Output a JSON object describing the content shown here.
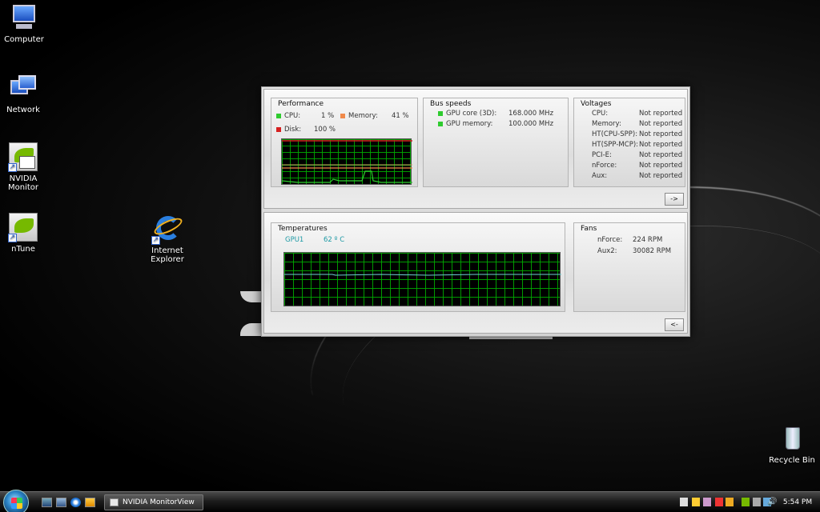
{
  "desktop": {
    "icons": [
      {
        "label": "Computer"
      },
      {
        "label": "Network"
      },
      {
        "label": "NVIDIA Monitor"
      },
      {
        "label": "nTune"
      },
      {
        "label": "Internet Explorer"
      },
      {
        "label": "Recycle Bin"
      }
    ]
  },
  "monitor": {
    "performance": {
      "title": "Performance",
      "cpu_label": "CPU:",
      "cpu_value": "1 %",
      "memory_label": "Memory:",
      "memory_value": "41 %",
      "disk_label": "Disk:",
      "disk_value": "100 %"
    },
    "bus_speeds": {
      "title": "Bus speeds",
      "items": [
        {
          "label": "GPU core (3D):",
          "value": "168.000 MHz"
        },
        {
          "label": "GPU memory:",
          "value": "100.000 MHz"
        }
      ]
    },
    "voltages": {
      "title": "Voltages",
      "items": [
        {
          "label": "CPU:",
          "value": "Not reported"
        },
        {
          "label": "Memory:",
          "value": "Not reported"
        },
        {
          "label": "HT(CPU-SPP):",
          "value": "Not reported"
        },
        {
          "label": "HT(SPP-MCP):",
          "value": "Not reported"
        },
        {
          "label": "PCI-E:",
          "value": "Not reported"
        },
        {
          "label": "nForce:",
          "value": "Not reported"
        },
        {
          "label": "Aux:",
          "value": "Not reported"
        }
      ]
    },
    "expand_button": "->",
    "temperatures": {
      "title": "Temperatures",
      "gpu_label": "GPU1",
      "gpu_value": "62 º C"
    },
    "fans": {
      "title": "Fans",
      "items": [
        {
          "label": "nForce:",
          "value": "224 RPM"
        },
        {
          "label": "Aux2:",
          "value": "30082 RPM"
        }
      ]
    },
    "collapse_button": "<-"
  },
  "taskbar": {
    "task_label": "NVIDIA MonitorView",
    "clock": "5:54 PM"
  },
  "colors": {
    "cpu": "#2fcb2f",
    "memory": "#f08a4b",
    "disk": "#d62020",
    "temperature_text": "#1e9aa5"
  }
}
